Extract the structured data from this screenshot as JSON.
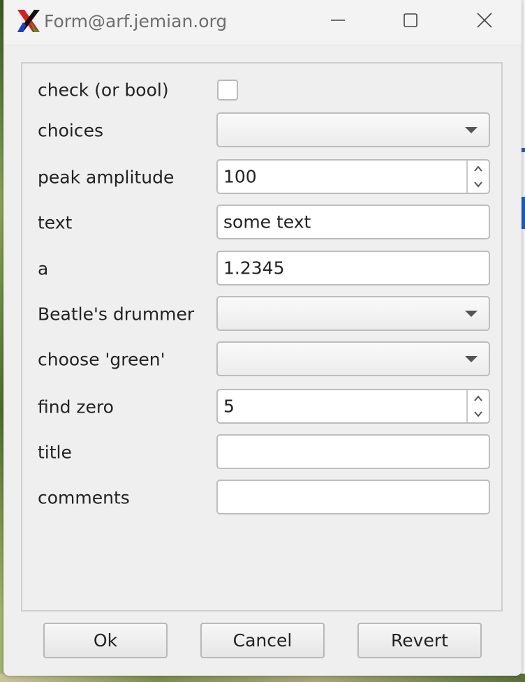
{
  "window": {
    "title": "Form@arf.jemian.org",
    "icons": {
      "app": "x11-logo-icon",
      "minimize": "minimize-icon",
      "maximize": "maximize-icon",
      "close": "close-icon"
    }
  },
  "form": {
    "fields": [
      {
        "label": "check (or bool)",
        "type": "checkbox",
        "checked": false
      },
      {
        "label": "choices",
        "type": "combobox",
        "value": ""
      },
      {
        "label": "peak amplitude",
        "type": "spinbox",
        "value": "100"
      },
      {
        "label": "text",
        "type": "text",
        "value": "some text"
      },
      {
        "label": "a",
        "type": "text",
        "value": "1.2345"
      },
      {
        "label": "Beatle's drummer",
        "type": "combobox",
        "value": ""
      },
      {
        "label": "choose 'green'",
        "type": "combobox",
        "value": ""
      },
      {
        "label": "find zero",
        "type": "spinbox",
        "value": "5"
      },
      {
        "label": "title",
        "type": "text",
        "value": ""
      },
      {
        "label": "comments",
        "type": "text",
        "value": ""
      }
    ]
  },
  "buttons": {
    "ok": "Ok",
    "cancel": "Cancel",
    "revert": "Revert"
  },
  "colors": {
    "window_bg": "#efefef",
    "field_border": "#bdbdbd",
    "title_text": "#6e6e6e"
  }
}
